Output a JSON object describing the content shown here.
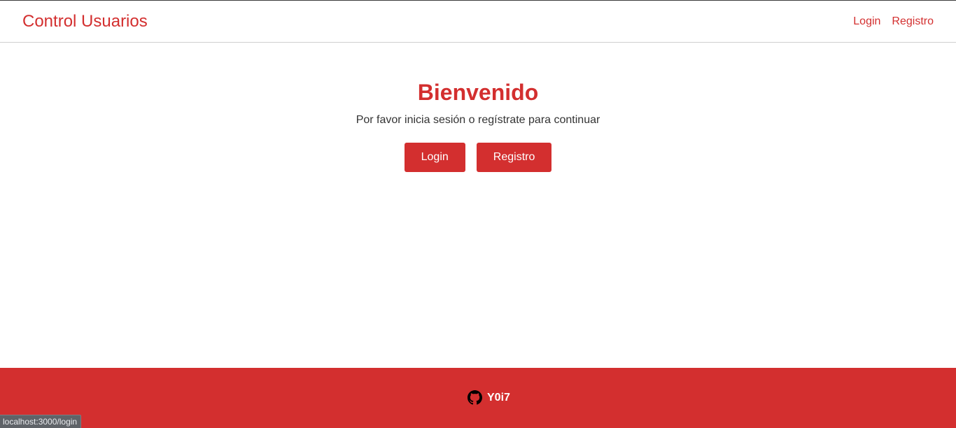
{
  "navbar": {
    "brand": "Control Usuarios",
    "links": [
      {
        "label": "Login"
      },
      {
        "label": "Registro"
      }
    ]
  },
  "hero": {
    "title": "Bienvenido",
    "subtitle": "Por favor inicia sesión o regístrate para continuar",
    "login_button": "Login",
    "register_button": "Registro"
  },
  "footer": {
    "github_icon": "github-icon",
    "username": "Y0i7"
  },
  "status_bar": {
    "url": "localhost:3000/login"
  },
  "colors": {
    "accent": "#d32f2f",
    "text": "#333333",
    "footer_text": "#ffffff"
  }
}
